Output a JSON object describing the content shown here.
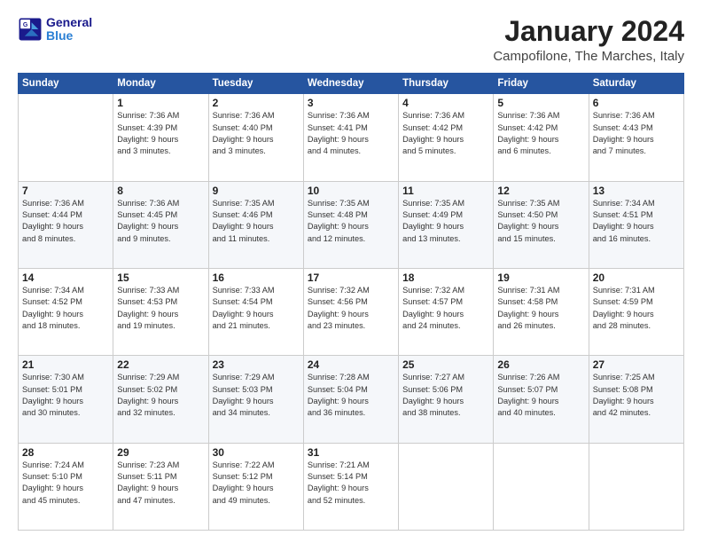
{
  "logo": {
    "line1": "General",
    "line2": "Blue"
  },
  "header": {
    "month": "January 2024",
    "location": "Campofilone, The Marches, Italy"
  },
  "weekdays": [
    "Sunday",
    "Monday",
    "Tuesday",
    "Wednesday",
    "Thursday",
    "Friday",
    "Saturday"
  ],
  "weeks": [
    [
      {
        "day": "",
        "info": ""
      },
      {
        "day": "1",
        "info": "Sunrise: 7:36 AM\nSunset: 4:39 PM\nDaylight: 9 hours\nand 3 minutes."
      },
      {
        "day": "2",
        "info": "Sunrise: 7:36 AM\nSunset: 4:40 PM\nDaylight: 9 hours\nand 3 minutes."
      },
      {
        "day": "3",
        "info": "Sunrise: 7:36 AM\nSunset: 4:41 PM\nDaylight: 9 hours\nand 4 minutes."
      },
      {
        "day": "4",
        "info": "Sunrise: 7:36 AM\nSunset: 4:42 PM\nDaylight: 9 hours\nand 5 minutes."
      },
      {
        "day": "5",
        "info": "Sunrise: 7:36 AM\nSunset: 4:42 PM\nDaylight: 9 hours\nand 6 minutes."
      },
      {
        "day": "6",
        "info": "Sunrise: 7:36 AM\nSunset: 4:43 PM\nDaylight: 9 hours\nand 7 minutes."
      }
    ],
    [
      {
        "day": "7",
        "info": "Sunrise: 7:36 AM\nSunset: 4:44 PM\nDaylight: 9 hours\nand 8 minutes."
      },
      {
        "day": "8",
        "info": "Sunrise: 7:36 AM\nSunset: 4:45 PM\nDaylight: 9 hours\nand 9 minutes."
      },
      {
        "day": "9",
        "info": "Sunrise: 7:35 AM\nSunset: 4:46 PM\nDaylight: 9 hours\nand 11 minutes."
      },
      {
        "day": "10",
        "info": "Sunrise: 7:35 AM\nSunset: 4:48 PM\nDaylight: 9 hours\nand 12 minutes."
      },
      {
        "day": "11",
        "info": "Sunrise: 7:35 AM\nSunset: 4:49 PM\nDaylight: 9 hours\nand 13 minutes."
      },
      {
        "day": "12",
        "info": "Sunrise: 7:35 AM\nSunset: 4:50 PM\nDaylight: 9 hours\nand 15 minutes."
      },
      {
        "day": "13",
        "info": "Sunrise: 7:34 AM\nSunset: 4:51 PM\nDaylight: 9 hours\nand 16 minutes."
      }
    ],
    [
      {
        "day": "14",
        "info": "Sunrise: 7:34 AM\nSunset: 4:52 PM\nDaylight: 9 hours\nand 18 minutes."
      },
      {
        "day": "15",
        "info": "Sunrise: 7:33 AM\nSunset: 4:53 PM\nDaylight: 9 hours\nand 19 minutes."
      },
      {
        "day": "16",
        "info": "Sunrise: 7:33 AM\nSunset: 4:54 PM\nDaylight: 9 hours\nand 21 minutes."
      },
      {
        "day": "17",
        "info": "Sunrise: 7:32 AM\nSunset: 4:56 PM\nDaylight: 9 hours\nand 23 minutes."
      },
      {
        "day": "18",
        "info": "Sunrise: 7:32 AM\nSunset: 4:57 PM\nDaylight: 9 hours\nand 24 minutes."
      },
      {
        "day": "19",
        "info": "Sunrise: 7:31 AM\nSunset: 4:58 PM\nDaylight: 9 hours\nand 26 minutes."
      },
      {
        "day": "20",
        "info": "Sunrise: 7:31 AM\nSunset: 4:59 PM\nDaylight: 9 hours\nand 28 minutes."
      }
    ],
    [
      {
        "day": "21",
        "info": "Sunrise: 7:30 AM\nSunset: 5:01 PM\nDaylight: 9 hours\nand 30 minutes."
      },
      {
        "day": "22",
        "info": "Sunrise: 7:29 AM\nSunset: 5:02 PM\nDaylight: 9 hours\nand 32 minutes."
      },
      {
        "day": "23",
        "info": "Sunrise: 7:29 AM\nSunset: 5:03 PM\nDaylight: 9 hours\nand 34 minutes."
      },
      {
        "day": "24",
        "info": "Sunrise: 7:28 AM\nSunset: 5:04 PM\nDaylight: 9 hours\nand 36 minutes."
      },
      {
        "day": "25",
        "info": "Sunrise: 7:27 AM\nSunset: 5:06 PM\nDaylight: 9 hours\nand 38 minutes."
      },
      {
        "day": "26",
        "info": "Sunrise: 7:26 AM\nSunset: 5:07 PM\nDaylight: 9 hours\nand 40 minutes."
      },
      {
        "day": "27",
        "info": "Sunrise: 7:25 AM\nSunset: 5:08 PM\nDaylight: 9 hours\nand 42 minutes."
      }
    ],
    [
      {
        "day": "28",
        "info": "Sunrise: 7:24 AM\nSunset: 5:10 PM\nDaylight: 9 hours\nand 45 minutes."
      },
      {
        "day": "29",
        "info": "Sunrise: 7:23 AM\nSunset: 5:11 PM\nDaylight: 9 hours\nand 47 minutes."
      },
      {
        "day": "30",
        "info": "Sunrise: 7:22 AM\nSunset: 5:12 PM\nDaylight: 9 hours\nand 49 minutes."
      },
      {
        "day": "31",
        "info": "Sunrise: 7:21 AM\nSunset: 5:14 PM\nDaylight: 9 hours\nand 52 minutes."
      },
      {
        "day": "",
        "info": ""
      },
      {
        "day": "",
        "info": ""
      },
      {
        "day": "",
        "info": ""
      }
    ]
  ]
}
